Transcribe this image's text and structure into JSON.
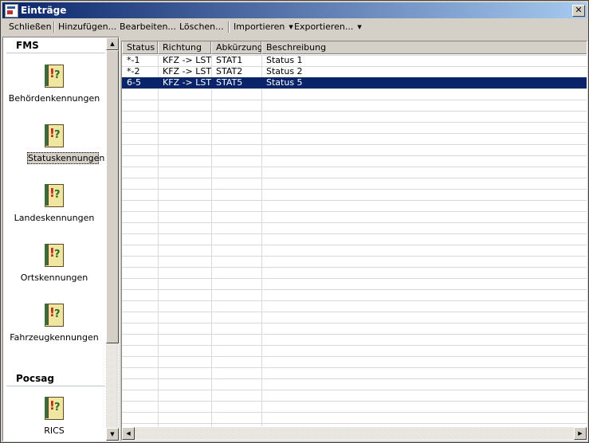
{
  "window": {
    "title": "Einträge"
  },
  "toolbar": {
    "close_label": "Schließen",
    "add_label": "Hinzufügen...",
    "edit_label": "Bearbeiten...",
    "delete_label": "Löschen...",
    "import_label": "Importieren",
    "export_label": "Exportieren..."
  },
  "nav": {
    "group_fms": "FMS",
    "group_pocsag": "Pocsag",
    "items": [
      {
        "label": "Behördenkennungen",
        "icon": "codebook-icon"
      },
      {
        "label": "Statuskennungen",
        "icon": "codebook-icon",
        "selected": true
      },
      {
        "label": "Landeskennungen",
        "icon": "codebook-icon"
      },
      {
        "label": "Ortskennungen",
        "icon": "codebook-icon"
      },
      {
        "label": "Fahrzeugkennungen",
        "icon": "codebook-icon"
      },
      {
        "label": "RICS",
        "icon": "codebook-icon"
      }
    ]
  },
  "table": {
    "columns": [
      "Status",
      "Richtung",
      "Abkürzung",
      "Beschreibung"
    ],
    "rows": [
      {
        "status": "*-1",
        "richtung": "KFZ -> LST",
        "abk": "STAT1",
        "beschreibung": "Status 1",
        "selected": false
      },
      {
        "status": "*-2",
        "richtung": "KFZ -> LST",
        "abk": "STAT2",
        "beschreibung": "Status 2",
        "selected": false
      },
      {
        "status": "6-5",
        "richtung": "KFZ -> LST",
        "abk": "STAT5",
        "beschreibung": "Status 5",
        "selected": true
      }
    ]
  },
  "colors": {
    "titlebar_start": "#0a246a",
    "selection": "#0a246a",
    "face": "#d4d0c8"
  }
}
